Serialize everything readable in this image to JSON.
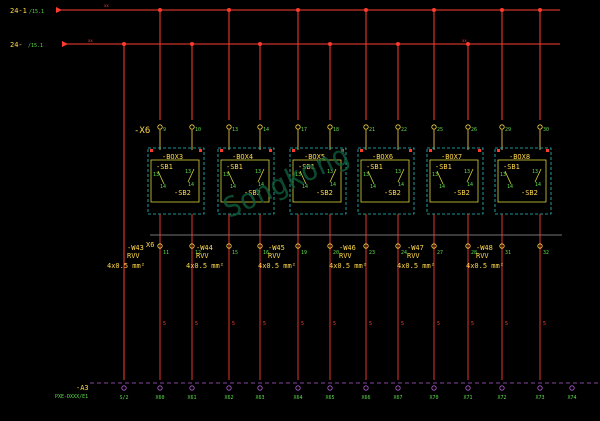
{
  "buses": [
    {
      "name": "24-1",
      "ref": "/15.1"
    },
    {
      "name": "24-",
      "ref": "/15.1"
    }
  ],
  "terminal_strip": "-X6",
  "terminal_strip_lower": "X6",
  "boxes": [
    {
      "name": "-BOX3",
      "sb1": "-SB1",
      "sb2": "-SB2",
      "tl": [
        "13",
        "14"
      ],
      "tr": [
        "13",
        "14"
      ]
    },
    {
      "name": "-BOX4",
      "sb1": "-SB1",
      "sb2": "-SB2",
      "tl": [
        "13",
        "14"
      ],
      "tr": [
        "13",
        "14"
      ]
    },
    {
      "name": "-BOX5",
      "sb1": "-SB1",
      "sb2": "-SB2",
      "tl": [
        "13",
        "14"
      ],
      "tr": [
        "13",
        "14"
      ]
    },
    {
      "name": "-BOX6",
      "sb1": "-SB1",
      "sb2": "-SB2",
      "tl": [
        "13",
        "14"
      ],
      "tr": [
        "13",
        "14"
      ]
    },
    {
      "name": "-BOX7",
      "sb1": "-SB1",
      "sb2": "-SB2",
      "tl": [
        "13",
        "14"
      ],
      "tr": [
        "13",
        "14"
      ]
    },
    {
      "name": "-BOX8",
      "sb1": "-SB1",
      "sb2": "-SB2",
      "tl": [
        "13",
        "14"
      ],
      "tr": [
        "13",
        "14"
      ]
    }
  ],
  "top_terminals": [
    "9",
    "10",
    "13",
    "14",
    "17",
    "18",
    "21",
    "22",
    "25",
    "26",
    "29",
    "30"
  ],
  "mid_terminals": [
    "11",
    "12",
    "15",
    "16",
    "19",
    "20",
    "23",
    "24",
    "27",
    "28",
    "31",
    "32"
  ],
  "cables": [
    {
      "name": "-W43",
      "type": "RVV",
      "spec": "4x0.5 mm²"
    },
    {
      "name": "-W44",
      "type": "RVV",
      "spec": "4x0.5 mm²"
    },
    {
      "name": "-W45",
      "type": "RVV",
      "spec": "4x0.5 mm²"
    },
    {
      "name": "-W46",
      "type": "RVV",
      "spec": "4x0.5 mm²"
    },
    {
      "name": "-W47",
      "type": "RVV",
      "spec": "4x0.5 mm²"
    },
    {
      "name": "-W48",
      "type": "RVV",
      "spec": "4x0.5 mm²"
    }
  ],
  "wire_label": "5",
  "device": {
    "name": "-A3",
    "ref": "PXE-DXXX/E1"
  },
  "bottom_terminals": [
    "S/2",
    "X60",
    "X61",
    "X62",
    "X63",
    "X64",
    "X65",
    "X66",
    "X67",
    "X70",
    "X71",
    "X72",
    "X73",
    "X74"
  ],
  "watermark": "Songkong",
  "colors": {
    "bg": "#000000",
    "bus": "#ff3b30",
    "wire": "#ffd84a",
    "box_outline": "#d7d43a",
    "cyan_dash": "#29c3c3",
    "green_text": "#5ddc4b",
    "label": "#ffd84a",
    "magenta": "#b45bd6",
    "white_text": "#e8e8e8"
  }
}
